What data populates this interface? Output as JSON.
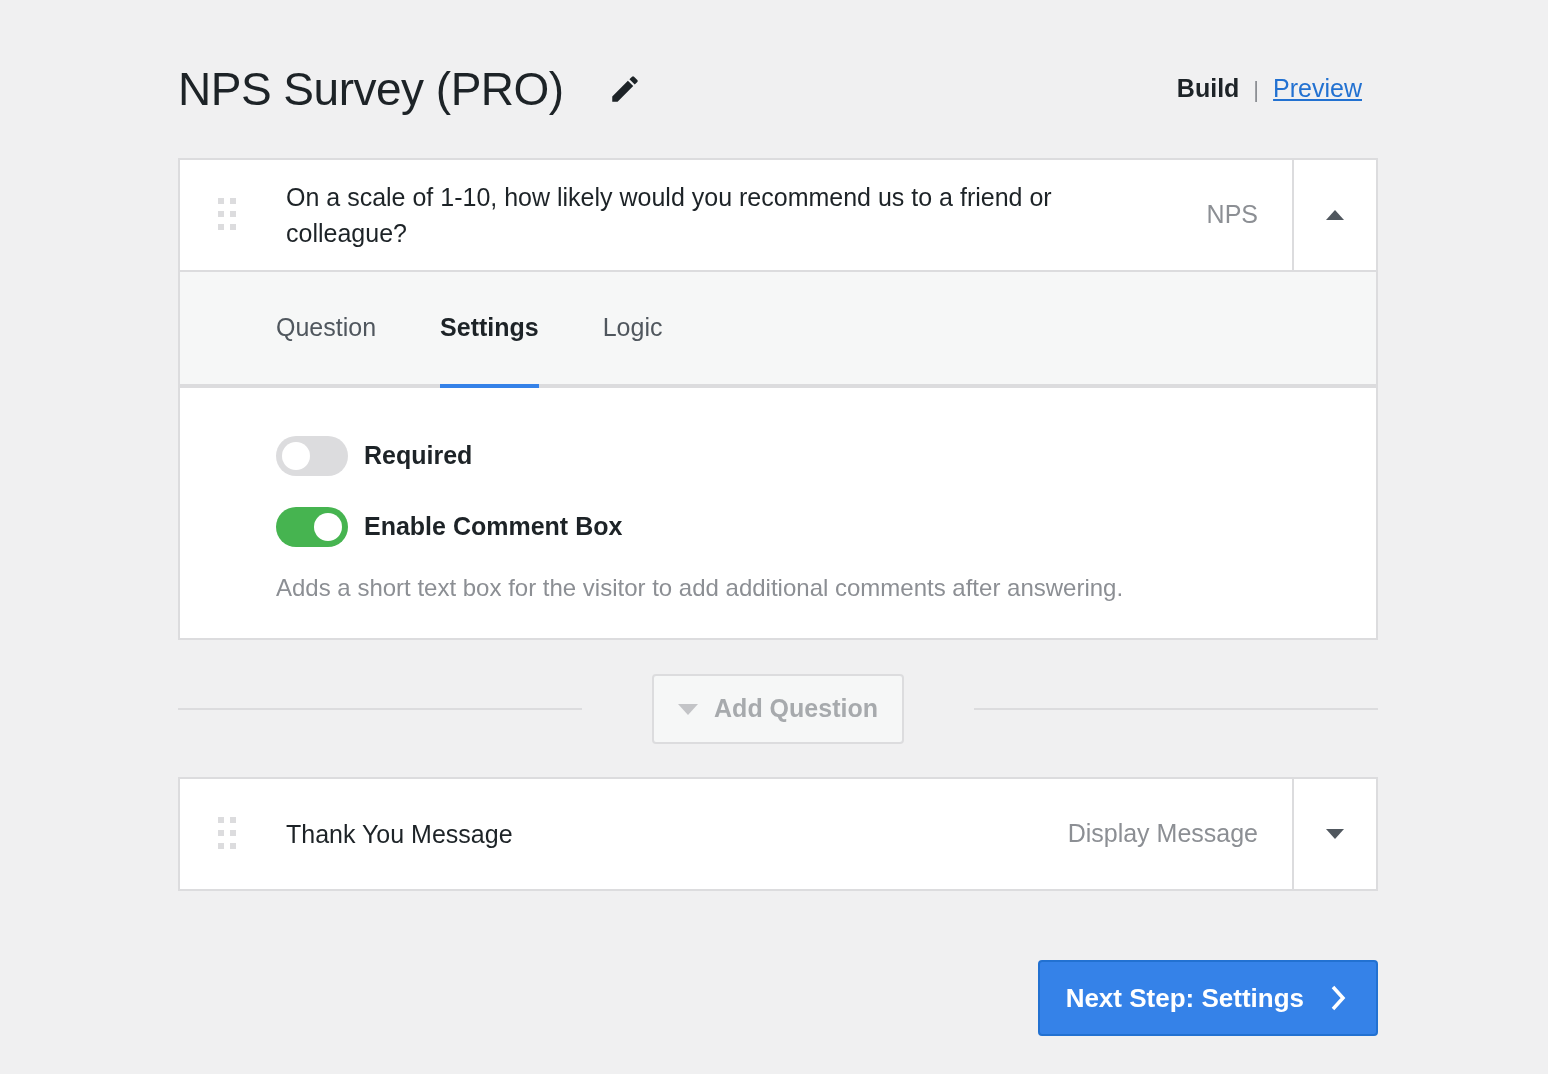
{
  "header": {
    "title": "NPS Survey (PRO)",
    "nav": [
      {
        "label": "Build",
        "selected": true
      },
      {
        "label": "Preview",
        "selected": false
      }
    ],
    "separator": "|"
  },
  "items": [
    {
      "title": "On a scale of 1-10, how likely would you recommend us to a friend or colleague?",
      "type": "NPS",
      "expanded": true,
      "tabs": [
        {
          "label": "Question",
          "selected": false
        },
        {
          "label": "Settings",
          "selected": true
        },
        {
          "label": "Logic",
          "selected": false
        }
      ],
      "settings": [
        {
          "label": "Required",
          "on": false
        },
        {
          "label": "Enable Comment Box",
          "on": true
        }
      ],
      "help": "Adds a short text box for the visitor to add additional comments after answering."
    }
  ],
  "add_question": {
    "label": "Add Question",
    "disabled": true
  },
  "end_items": [
    {
      "title": "Thank You Message",
      "type": "Display Message",
      "expanded": false
    }
  ],
  "next_button": "Next Step: Settings"
}
